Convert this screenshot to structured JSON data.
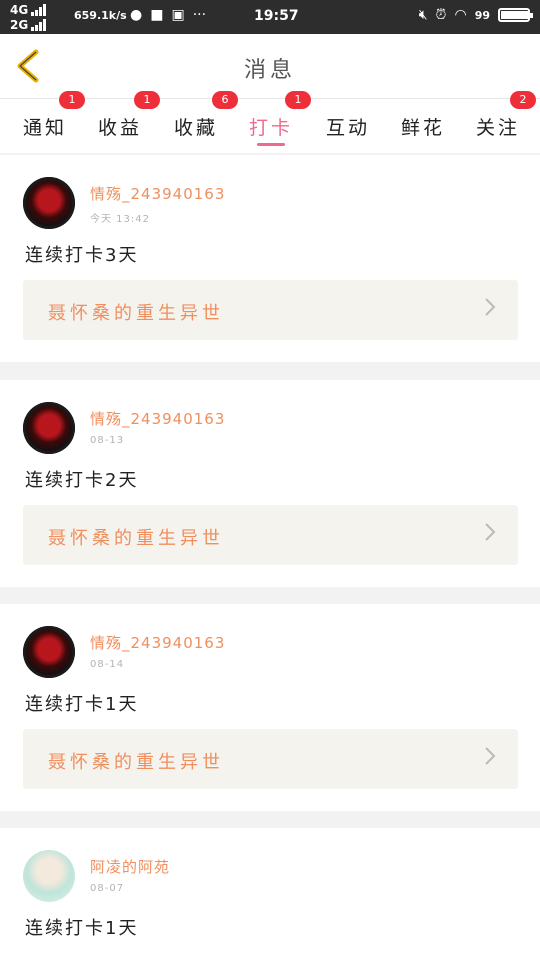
{
  "status_bar": {
    "net_top": "4G",
    "net_bottom": "2G",
    "speed": "659.1k/s",
    "time": "19:57",
    "battery": "99",
    "battery_level": 0.99
  },
  "header": {
    "title": "消息"
  },
  "tabs": [
    {
      "label": "通知",
      "badge": "1"
    },
    {
      "label": "收益",
      "badge": "1"
    },
    {
      "label": "收藏",
      "badge": "6"
    },
    {
      "label": "打卡",
      "badge": "1",
      "active": true
    },
    {
      "label": "互动",
      "badge": ""
    },
    {
      "label": "鲜花",
      "badge": ""
    },
    {
      "label": "关注",
      "badge": "2"
    }
  ],
  "messages": [
    {
      "user": "情殇_243940163",
      "time": "今天 13:42",
      "text": "连续打卡3天",
      "book": "聂怀桑的重生异世"
    },
    {
      "user": "情殇_243940163",
      "time": "08-13",
      "text": "连续打卡2天",
      "book": "聂怀桑的重生异世"
    },
    {
      "user": "情殇_243940163",
      "time": "08-14",
      "text": "连续打卡1天",
      "book": "聂怀桑的重生异世"
    },
    {
      "user": "阿凌的阿苑",
      "time": "08-07",
      "text": "连续打卡1天",
      "book": ""
    }
  ],
  "colors": {
    "accent": "#ee6a8e",
    "username": "#f08f5e",
    "badge": "#ee2f3a",
    "back_arrow": "#e8b000"
  }
}
